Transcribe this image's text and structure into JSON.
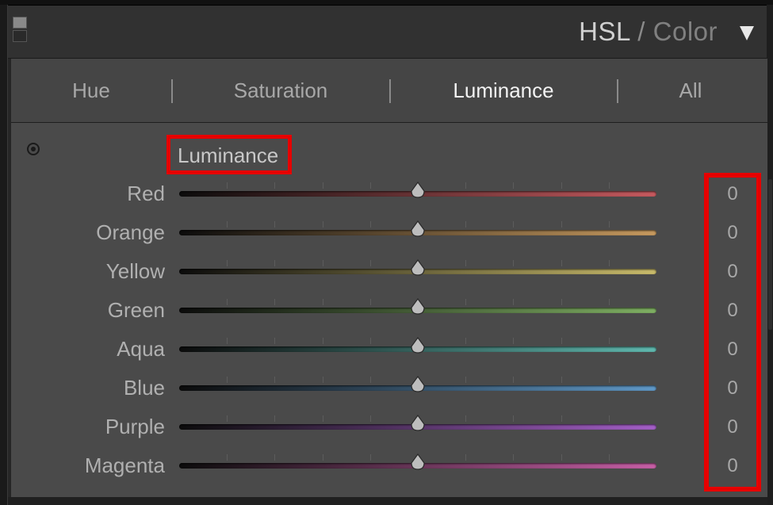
{
  "header": {
    "title_primary": "HSL",
    "title_separator": "/",
    "title_secondary": "Color"
  },
  "tabs": [
    {
      "label": "Hue",
      "active": false
    },
    {
      "label": "Saturation",
      "active": false
    },
    {
      "label": "Luminance",
      "active": true
    },
    {
      "label": "All",
      "active": false
    }
  ],
  "section": {
    "label": "Luminance",
    "icon": "target-adjust-icon"
  },
  "sliders": [
    {
      "label": "Red",
      "value": "0",
      "color": "#c75a5f"
    },
    {
      "label": "Orange",
      "value": "0",
      "color": "#c79a5f"
    },
    {
      "label": "Yellow",
      "value": "0",
      "color": "#c9bb6b"
    },
    {
      "label": "Green",
      "value": "0",
      "color": "#7fb063"
    },
    {
      "label": "Aqua",
      "value": "0",
      "color": "#5fb8ae"
    },
    {
      "label": "Blue",
      "value": "0",
      "color": "#5f98c7"
    },
    {
      "label": "Purple",
      "value": "0",
      "color": "#a45fc7"
    },
    {
      "label": "Magenta",
      "value": "0",
      "color": "#c75fa6"
    }
  ],
  "slider_range": [
    -100,
    100
  ],
  "highlight_color": "#e60000"
}
